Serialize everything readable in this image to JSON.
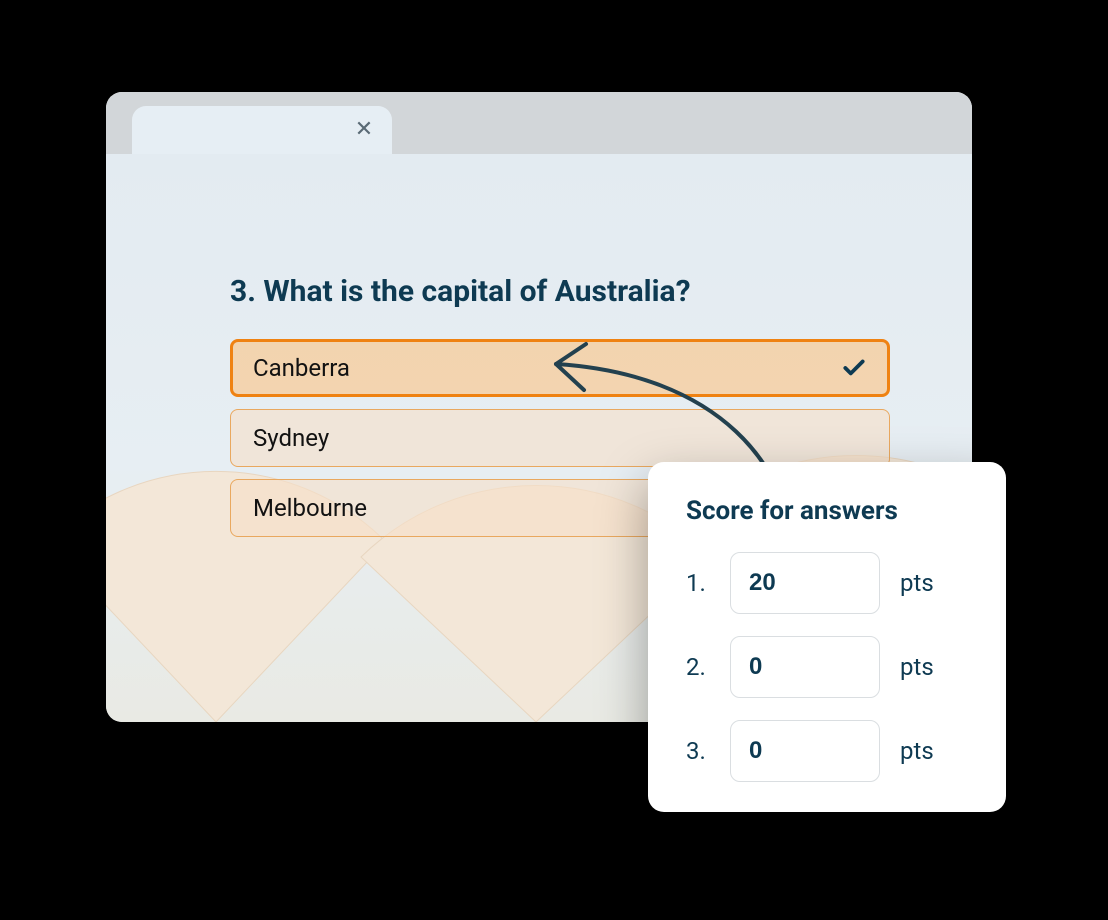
{
  "question": {
    "number": "3.",
    "text": "What is the capital of Australia?",
    "options": [
      {
        "label": "Canberra",
        "selected": true
      },
      {
        "label": "Sydney",
        "selected": false
      },
      {
        "label": "Melbourne",
        "selected": false
      }
    ]
  },
  "scorecard": {
    "title": "Score for answers",
    "unit": "pts",
    "rows": [
      {
        "index": "1.",
        "value": "20"
      },
      {
        "index": "2.",
        "value": "0"
      },
      {
        "index": "3.",
        "value": "0"
      }
    ]
  },
  "colors": {
    "accent": "#ef8212",
    "textDark": "#0e3a52"
  }
}
